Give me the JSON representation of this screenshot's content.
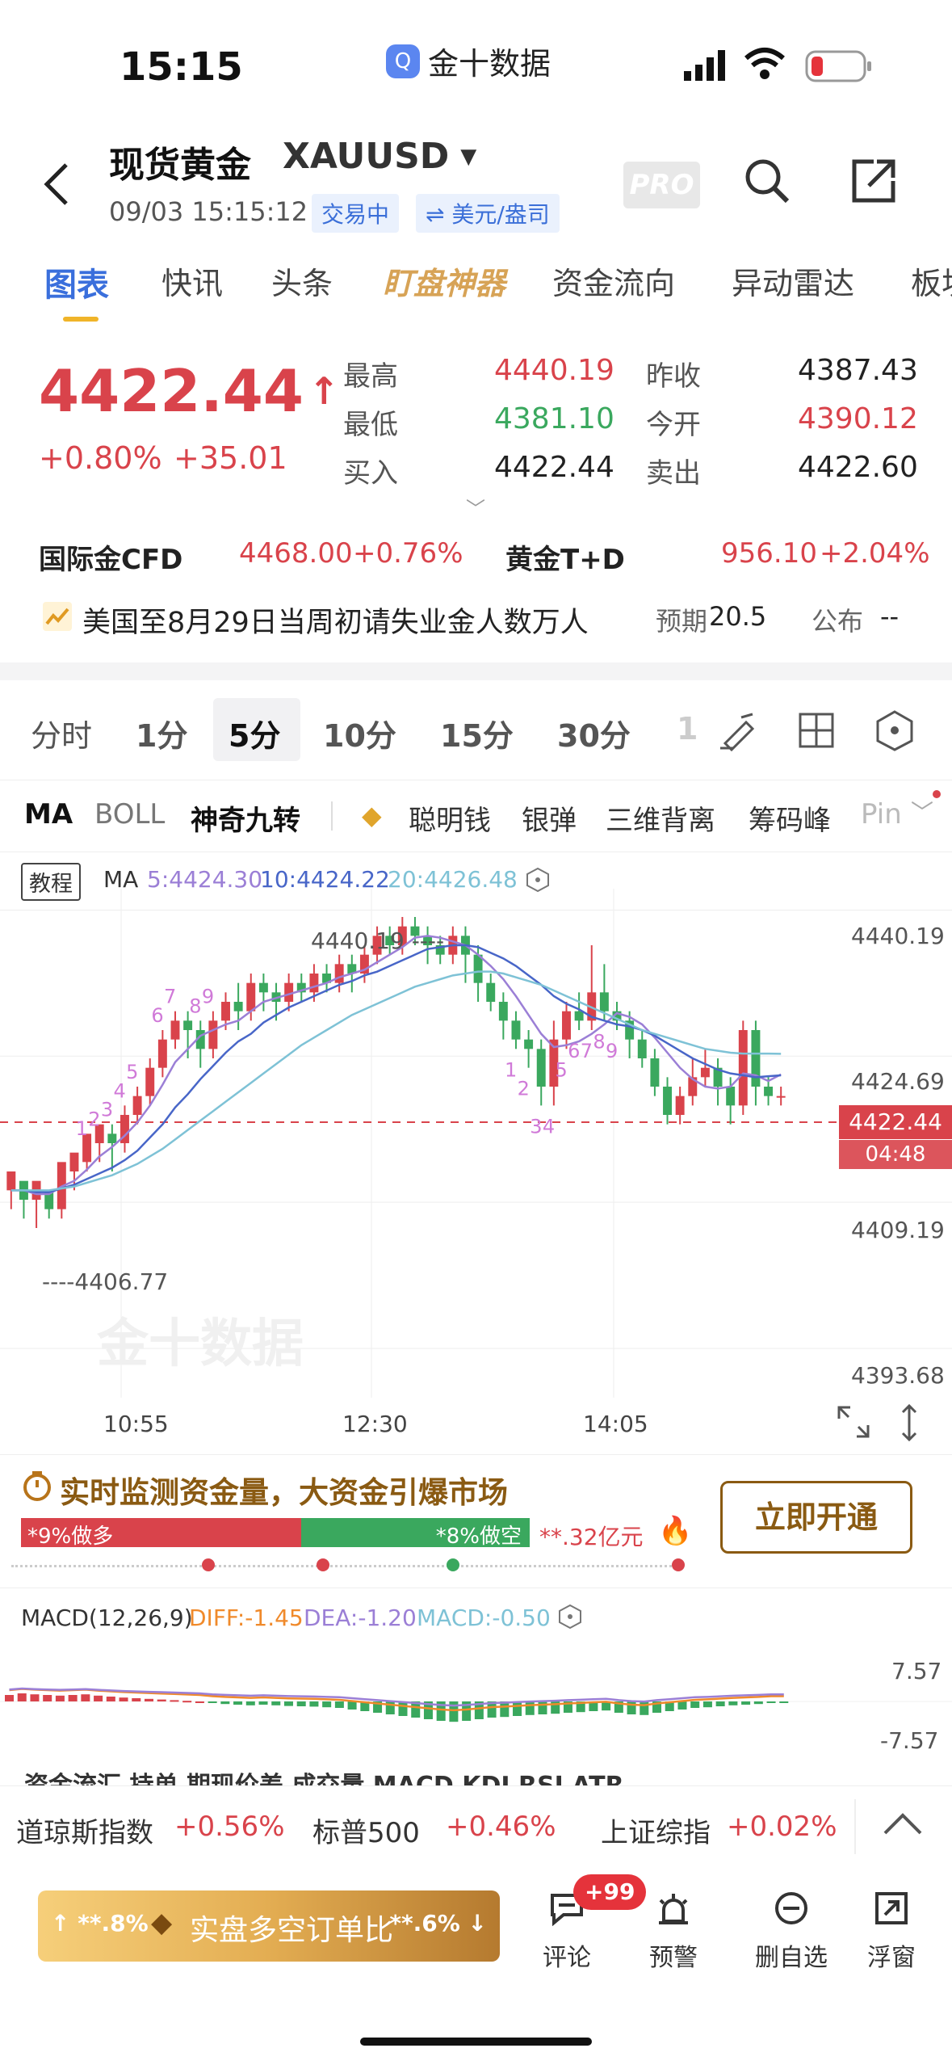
{
  "status": {
    "time": "15:15",
    "app_name": "金十数据"
  },
  "header": {
    "title": "现货黄金",
    "symbol": "XAUUSD",
    "datetime": "09/03 15:15:12",
    "trade_status": "交易中",
    "currency": "⇌ 美元/盎司",
    "pro": "PRO"
  },
  "tabs": [
    "图表",
    "快讯",
    "头条",
    "盯盘神器",
    "资金流向",
    "异动雷达",
    "板块"
  ],
  "quote": {
    "price": "4422.44",
    "arrow": "↑",
    "change_pct": "+0.80%",
    "change": "+35.01",
    "stats": [
      {
        "label": "最高",
        "value": "4440.19",
        "color": "red"
      },
      {
        "label": "昨收",
        "value": "4387.43",
        "color": "dark"
      },
      {
        "label": "最低",
        "value": "4381.10",
        "color": "green"
      },
      {
        "label": "今开",
        "value": "4390.12",
        "color": "red"
      },
      {
        "label": "买入",
        "value": "4422.44",
        "color": "dark"
      },
      {
        "label": "卖出",
        "value": "4422.60",
        "color": "dark"
      }
    ],
    "related": [
      {
        "name": "国际金CFD",
        "price": "4468.00",
        "pct": "+0.76%"
      },
      {
        "name": "黄金T+D",
        "price": "956.10",
        "pct": "+2.04%"
      }
    ]
  },
  "news": {
    "text": "美国至8月29日当周初请失业金人数万人",
    "expected_label": "预期",
    "expected": "20.5",
    "published_label": "公布",
    "published": "--"
  },
  "periods": [
    "分时",
    "1分",
    "5分",
    "10分",
    "15分",
    "30分",
    "1"
  ],
  "selected_period": "5分",
  "indicators": [
    "MA",
    "BOLL",
    "神奇九转",
    "聪明钱",
    "银弹",
    "三维背离",
    "筹码峰",
    "Pin"
  ],
  "chart": {
    "tutorial": "教程",
    "ma_label": "MA",
    "ma5": "5:4424.30",
    "ma10": "10:4424.22",
    "ma20": "20:4426.48",
    "y_ticks": [
      "4440.19",
      "4424.69",
      "4409.19",
      "4393.68"
    ],
    "x_ticks": [
      "10:55",
      "12:30",
      "14:05"
    ],
    "high_label": "4440.19 ----",
    "low_label": "----4406.77",
    "current_price": "4422.44",
    "countdown": "04:48",
    "watermark": "金十数据",
    "colors": {
      "up": "#d9434b",
      "down": "#3aa85e",
      "ma5": "#9b7fd6",
      "ma10": "#4866c8",
      "ma20": "#7ec2d6"
    }
  },
  "chart_data": {
    "type": "candlestick",
    "ohlc": [
      [
        4412,
        4414,
        4410,
        4413
      ],
      [
        4413,
        4411,
        4409,
        4412
      ],
      [
        4411,
        4413,
        4408,
        4412
      ],
      [
        4412,
        4410,
        4409,
        4411
      ],
      [
        4410,
        4415,
        4409,
        4414
      ],
      [
        4414,
        4416,
        4412,
        4415
      ],
      [
        4415,
        4418,
        4414,
        4417
      ],
      [
        4417,
        4419,
        4415,
        4418
      ],
      [
        4418,
        4417,
        4414,
        4419
      ],
      [
        4417,
        4420,
        4416,
        4421
      ],
      [
        4420,
        4422,
        4419,
        4423
      ],
      [
        4422,
        4425,
        4421,
        4426
      ],
      [
        4425,
        4428,
        4424,
        4429
      ],
      [
        4428,
        4430,
        4427,
        4431
      ],
      [
        4430,
        4429,
        4426,
        4431
      ],
      [
        4429,
        4427,
        4425,
        4430
      ],
      [
        4427,
        4430,
        4426,
        4431
      ],
      [
        4430,
        4432,
        4429,
        4433
      ],
      [
        4432,
        4431,
        4429,
        4434
      ],
      [
        4431,
        4434,
        4430,
        4435
      ],
      [
        4434,
        4433,
        4431,
        4435
      ],
      [
        4433,
        4432,
        4430,
        4434
      ],
      [
        4432,
        4434,
        4431,
        4435
      ],
      [
        4434,
        4433,
        4432,
        4435
      ],
      [
        4433,
        4435,
        4432,
        4436
      ],
      [
        4435,
        4434,
        4433,
        4436
      ],
      [
        4434,
        4436,
        4433,
        4437
      ],
      [
        4436,
        4435,
        4433,
        4437
      ],
      [
        4435,
        4437,
        4434,
        4438
      ],
      [
        4437,
        4439,
        4436,
        4440
      ],
      [
        4439,
        4438,
        4437,
        4440
      ],
      [
        4438,
        4440,
        4437,
        4441
      ],
      [
        4440,
        4439,
        4438,
        4441
      ],
      [
        4439,
        4438,
        4436,
        4440
      ],
      [
        4438,
        4437,
        4436,
        4439
      ],
      [
        4437,
        4439,
        4436,
        4440
      ],
      [
        4439,
        4437,
        4434,
        4440
      ],
      [
        4437,
        4434,
        4432,
        4438
      ],
      [
        4434,
        4432,
        4431,
        4435
      ],
      [
        4432,
        4430,
        4428,
        4433
      ],
      [
        4430,
        4428,
        4427,
        4431
      ],
      [
        4428,
        4427,
        4425,
        4429
      ],
      [
        4427,
        4423,
        4421,
        4428
      ],
      [
        4423,
        4428,
        4421,
        4430
      ],
      [
        4428,
        4431,
        4427,
        4432
      ],
      [
        4431,
        4430,
        4429,
        4433
      ],
      [
        4430,
        4433,
        4429,
        4438
      ],
      [
        4433,
        4431,
        4430,
        4436
      ],
      [
        4431,
        4430,
        4429,
        4432
      ],
      [
        4430,
        4428,
        4426,
        4431
      ],
      [
        4428,
        4426,
        4425,
        4429
      ],
      [
        4426,
        4423,
        4422,
        4427
      ],
      [
        4423,
        4420,
        4419,
        4424
      ],
      [
        4420,
        4422,
        4419,
        4423
      ],
      [
        4422,
        4424,
        4421,
        4426
      ],
      [
        4424,
        4425,
        4423,
        4427
      ],
      [
        4425,
        4423,
        4421,
        4426
      ],
      [
        4423,
        4421,
        4419,
        4424
      ],
      [
        4421,
        4429,
        4420,
        4430
      ],
      [
        4429,
        4423,
        4421,
        4430
      ],
      [
        4423,
        4422,
        4421,
        4424
      ],
      [
        4422,
        4422,
        4421,
        4423
      ]
    ],
    "ma5": [
      4412,
      4412,
      4411.6,
      4411.6,
      4412.4,
      4413,
      4414.2,
      4415.6,
      4416.6,
      4417.8,
      4419.2,
      4421,
      4423.2,
      4425.6,
      4427,
      4428.4,
      4429,
      4429.6,
      4430,
      4431,
      4432,
      4432.4,
      4432.8,
      4433.2,
      4433.6,
      4434,
      4434.6,
      4435,
      4435.4,
      4436.2,
      4437,
      4437.8,
      4438.8,
      4439,
      4438.8,
      4438.4,
      4438,
      4437,
      4435.8,
      4434.4,
      4432.6,
      4430.6,
      4428.6,
      4427.2,
      4427.4,
      4427.8,
      4428.6,
      4429.6,
      4430.8,
      4430.4,
      4429.6,
      4428.2,
      4426.6,
      4425,
      4423.8,
      4423,
      4422.8,
      4423,
      4424.4,
      4424.2,
      4423.6,
      4424.3
    ],
    "ma10": [
      4412,
      4412,
      4411.8,
      4411.8,
      4412.2,
      4412.6,
      4413.2,
      4413.8,
      4414.4,
      4415.2,
      4416.2,
      4417.6,
      4419,
      4420.8,
      4422.2,
      4423.8,
      4425.2,
      4426.6,
      4427.8,
      4428.6,
      4429.8,
      4430.6,
      4431.4,
      4432,
      4432.6,
      4433.2,
      4433.8,
      4434.2,
      4434.8,
      4435.2,
      4435.8,
      4436.4,
      4437,
      4437.6,
      4437.8,
      4438,
      4438,
      4437.8,
      4437.2,
      4436.6,
      4435.8,
      4434.8,
      4433.8,
      4432.6,
      4431.8,
      4431.2,
      4430.4,
      4430,
      4429.6,
      4429.4,
      4429,
      4428.4,
      4427.6,
      4426.8,
      4426,
      4425.4,
      4424.8,
      4424.4,
      4424.2,
      4424,
      4424.1,
      4424.2
    ],
    "ma20": [
      4412,
      4412,
      4412,
      4412,
      4412.2,
      4412.4,
      4412.8,
      4413.2,
      4413.6,
      4414.2,
      4414.8,
      4415.6,
      4416.4,
      4417.4,
      4418.4,
      4419.4,
      4420.4,
      4421.4,
      4422.4,
      4423.4,
      4424.4,
      4425.4,
      4426.4,
      4427.4,
      4428.2,
      4429,
      4429.8,
      4430.6,
      4431.2,
      4431.8,
      4432.4,
      4433,
      4433.6,
      4434,
      4434.4,
      4434.8,
      4435,
      4435.2,
      4435.2,
      4435,
      4434.6,
      4434.2,
      4433.8,
      4433.2,
      4432.6,
      4432,
      4431.4,
      4430.8,
      4430.2,
      4429.6,
      4429,
      4428.6,
      4428.2,
      4427.8,
      4427.4,
      4427,
      4426.8,
      4426.6,
      4426.5,
      4426.5,
      4426.5,
      4426.48
    ],
    "ylim": [
      4393.68,
      4440.19
    ],
    "td_labels": [
      {
        "i": 6,
        "t": "1"
      },
      {
        "i": 7,
        "t": "2"
      },
      {
        "i": 8,
        "t": "3"
      },
      {
        "i": 9,
        "t": "4"
      },
      {
        "i": 10,
        "t": "5"
      },
      {
        "i": 12,
        "t": "6"
      },
      {
        "i": 13,
        "t": "7"
      },
      {
        "i": 15,
        "t": "8"
      },
      {
        "i": 16,
        "t": "9"
      },
      {
        "i": 40,
        "t": "1"
      },
      {
        "i": 41,
        "t": "2"
      },
      {
        "i": 42,
        "t": "3"
      },
      {
        "i": 43,
        "t": "4"
      },
      {
        "i": 44,
        "t": "5"
      },
      {
        "i": 45,
        "t": "6"
      },
      {
        "i": 46,
        "t": "7"
      },
      {
        "i": 47,
        "t": "8"
      },
      {
        "i": 48,
        "t": "9"
      }
    ]
  },
  "promo": {
    "title": "实时监测资金量，大资金引爆市场",
    "long_label": "*9%做多",
    "short_label": "*8%做空",
    "amount": "**.32亿元",
    "long_ratio": 0.55,
    "cta": "立即开通"
  },
  "macd": {
    "label": "MACD(12,26,9)",
    "diff": "DIFF:-1.45",
    "dea": "DEA:-1.20",
    "macd": "MACD:-0.50",
    "y_top": "7.57",
    "y_bottom": "-7.57",
    "hist": [
      2,
      2.5,
      2.2,
      2,
      1.8,
      2,
      2.2,
      1.8,
      1.5,
      1.2,
      1,
      0.8,
      0.6,
      0.4,
      0.2,
      0,
      -0.5,
      -0.8,
      -1,
      -1.2,
      -1,
      -1.2,
      -1.4,
      -1.5,
      -1.6,
      -1.8,
      -2,
      -2.5,
      -3,
      -3.5,
      -4,
      -4.5,
      -5,
      -5.5,
      -6,
      -6.3,
      -6,
      -5.5,
      -5,
      -4.8,
      -4.5,
      -4.2,
      -4,
      -3.8,
      -3.5,
      -3.3,
      -3,
      -2.8,
      -3.5,
      -4,
      -4.2,
      -3.5,
      -3,
      -2.5,
      -2,
      -1.8,
      -1.5,
      -1.2,
      -1,
      -0.8,
      -0.5,
      -0.5
    ]
  },
  "index_bar": [
    {
      "name": "道琼斯指数",
      "pct": "+0.56%"
    },
    {
      "name": "标普500",
      "pct": "+0.46%"
    },
    {
      "name": "上证综指",
      "pct": "+0.02%"
    }
  ],
  "index_bar_behind": "资金流汇 持单 期现价差 成交量 MACD KDJ RSI ATR",
  "bottom": {
    "ratio_label": "实盘多空订单比",
    "left_pct": "↑ **.8%",
    "right_pct": "**.6% ↓",
    "nav": [
      {
        "label": "评论",
        "badge": "+99"
      },
      {
        "label": "预警"
      },
      {
        "label": "删自选"
      },
      {
        "label": "浮窗"
      }
    ]
  }
}
